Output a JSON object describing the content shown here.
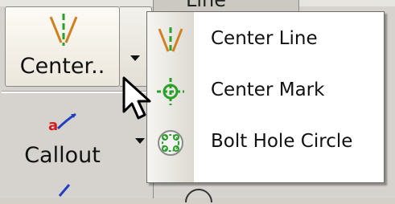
{
  "toolbar": {
    "center_button_label": "Center..",
    "callout_button_label": "Callout",
    "behind_panel_text": "Line",
    "colors": {
      "center_line_green": "#2aa02a",
      "center_line_orange": "#d08020",
      "callout_red": "#cc2020",
      "callout_blue": "#2040c0"
    }
  },
  "menu": {
    "items": [
      {
        "label": "Center Line",
        "icon": "center-line-icon"
      },
      {
        "label": "Center Mark",
        "icon": "center-mark-icon"
      },
      {
        "label": "Bolt Hole Circle",
        "icon": "bolt-hole-circle-icon"
      }
    ]
  }
}
